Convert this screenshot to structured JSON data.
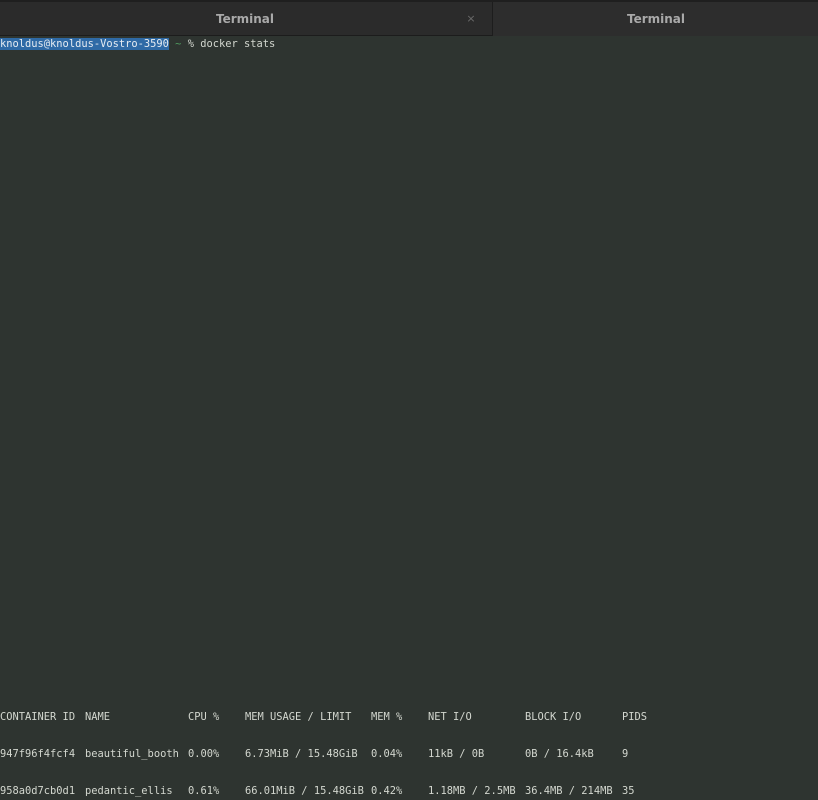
{
  "tabs": [
    {
      "title": "Terminal",
      "close_glyph": "×"
    },
    {
      "title": "Terminal"
    }
  ],
  "terminal": {
    "prompt": {
      "user_host": "knoldus@knoldus-Vostro-3590",
      "cwd": "~",
      "symbol": "%",
      "command": "docker stats"
    },
    "stats": {
      "headers": [
        "CONTAINER ID",
        "NAME",
        "CPU %",
        "MEM USAGE / LIMIT",
        "MEM %",
        "NET I/O",
        "BLOCK I/O",
        "PIDS"
      ],
      "rows": [
        [
          "947f96f4fcf4",
          "beautiful_booth",
          "0.00%",
          "6.73MiB / 15.48GiB",
          "0.04%",
          "11kB / 0B",
          "0B / 16.4kB",
          "9"
        ],
        [
          "958a0d7cb0d1",
          "pedantic_ellis",
          "0.61%",
          "66.01MiB / 15.48GiB",
          "0.42%",
          "1.18MB / 2.5MB",
          "36.4MB / 214MB",
          "35"
        ]
      ]
    }
  },
  "colors": {
    "background": "#2e3430",
    "foreground": "#d3d7cf",
    "selection": "#2f6aa6",
    "cwd": "#4e9a5e"
  }
}
